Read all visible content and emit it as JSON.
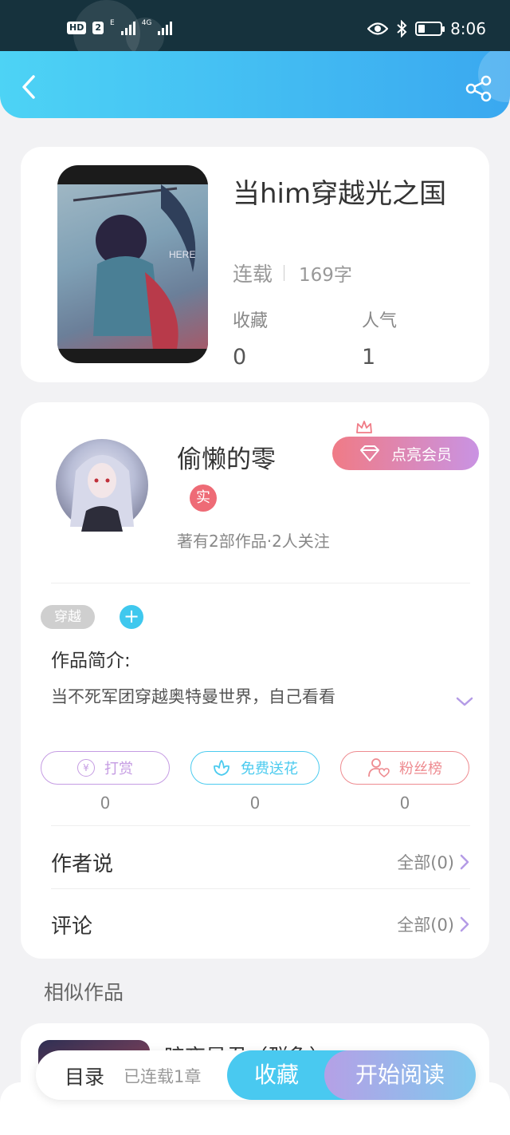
{
  "status_bar": {
    "hd": "HD",
    "sim": "2",
    "net1": "E",
    "net2": "4G",
    "time": "8:06"
  },
  "book": {
    "title": "当him穿越光之国",
    "status": "连载",
    "word_count": "169字",
    "stats": [
      {
        "label": "收藏",
        "value": "0"
      },
      {
        "label": "人气",
        "value": "1"
      }
    ],
    "cover_text": "HERE"
  },
  "author": {
    "name": "偷懒的零",
    "verified": "实",
    "meta": "著有2部作品·2人关注",
    "vip_label": "点亮会员"
  },
  "tags": [
    "穿越"
  ],
  "add_tag": "+",
  "intro": {
    "label": "作品简介:",
    "text": "当不死军团穿越奥特曼世界，自己看看"
  },
  "actions": [
    {
      "icon": "¥",
      "label": "打赏",
      "count": "0",
      "color": "#c59ce3"
    },
    {
      "icon": "flower-icon",
      "label": "免费送花",
      "count": "0",
      "color": "#4ccbef"
    },
    {
      "icon": "user-heart-icon",
      "label": "粉丝榜",
      "count": "0",
      "color": "#ee8b90"
    }
  ],
  "rows": [
    {
      "title": "作者说",
      "more": "全部(0)"
    },
    {
      "title": "评论",
      "more": "全部(0)"
    }
  ],
  "similar": {
    "label": "相似作品",
    "first_title": "暗夜星君（群象）"
  },
  "bottom_bar": {
    "toc": "目录",
    "toc_meta": "已连载1章",
    "favorite": "收藏",
    "start_reading": "开始阅读"
  },
  "colors": {
    "accent": "#3fc8ee",
    "vip_start": "#f07b86",
    "vip_end": "#c993e3",
    "status_bar_bg": "#16323d"
  }
}
